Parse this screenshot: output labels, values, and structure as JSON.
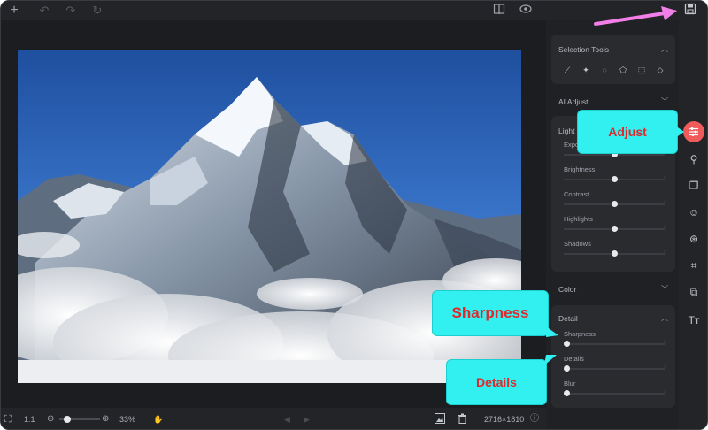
{
  "toolbar": {
    "icons": [
      "add-icon",
      "undo-icon",
      "redo-icon",
      "reset-icon",
      "compare-icon",
      "preview-eye-icon",
      "save-icon"
    ]
  },
  "bottom_bar": {
    "ratio_label": "1:1",
    "zoom_percent": "33%",
    "zoom_level": 0.33,
    "dimensions": "2716×1810"
  },
  "panel": {
    "selection_tools": {
      "title": "Selection Tools",
      "tools": [
        "brush-icon",
        "pin-icon",
        "lasso-icon",
        "polygon-lasso-icon",
        "rect-select-icon",
        "eraser-icon"
      ]
    },
    "ai_adjust": {
      "title": "AI Adjust"
    },
    "light": {
      "title": "Light",
      "sliders": [
        {
          "label": "Exposure",
          "value": 0.5
        },
        {
          "label": "Brightness",
          "value": 0.5
        },
        {
          "label": "Contrast",
          "value": 0.5
        },
        {
          "label": "Highlights",
          "value": 0.5
        },
        {
          "label": "Shadows",
          "value": 0.5
        }
      ]
    },
    "color": {
      "title": "Color"
    },
    "detail": {
      "title": "Detail",
      "sliders": [
        {
          "label": "Sharpness",
          "value": 0.0
        },
        {
          "label": "Details",
          "value": 0.0
        },
        {
          "label": "Blur",
          "value": 0.0
        }
      ]
    }
  },
  "side_strip": {
    "icons": [
      "adjust-sliders-icon",
      "stamp-icon",
      "layers-icon",
      "face-icon",
      "color-circles-icon",
      "crop-icon",
      "resize-icon",
      "text-icon"
    ]
  },
  "annotations": {
    "adjust": "Adjust",
    "sharpness": "Sharpness",
    "details": "Details",
    "arrow_color": "#f27ee8",
    "callout_bg": "#33f0f0",
    "callout_text": "#e0282c"
  }
}
